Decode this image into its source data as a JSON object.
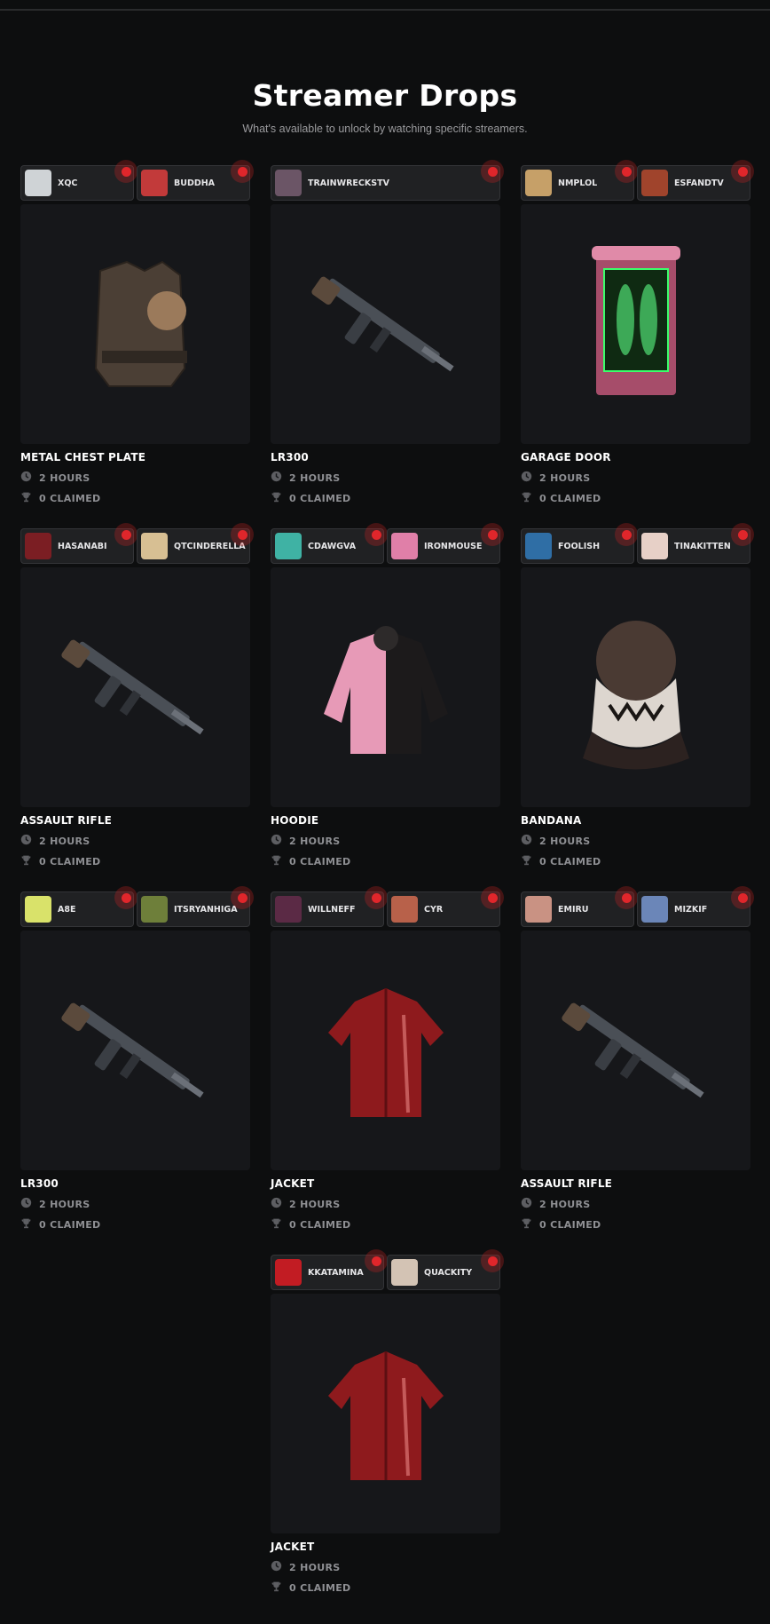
{
  "header": {
    "title": "Streamer Drops",
    "subtitle": "What's available to unlock by watching specific streamers."
  },
  "colors": {
    "background": "#0d0e0f",
    "card": "#16171a",
    "tab": "#202123",
    "live": "#e0262b"
  },
  "drops": [
    {
      "item": "METAL CHEST PLATE",
      "duration": "2 HOURS",
      "claimed": "0 CLAIMED",
      "icon": "chest-plate-icon",
      "streamers": [
        {
          "name": "XQC",
          "color": "#cfd3d6"
        },
        {
          "name": "BUDDHA",
          "color": "#c23a3a"
        }
      ]
    },
    {
      "item": "LR300",
      "duration": "2 HOURS",
      "claimed": "0 CLAIMED",
      "icon": "rifle-icon",
      "streamers": [
        {
          "name": "TRAINWRECKSTV",
          "color": "#6b5566"
        }
      ]
    },
    {
      "item": "GARAGE DOOR",
      "duration": "2 HOURS",
      "claimed": "0 CLAIMED",
      "icon": "garage-door-icon",
      "streamers": [
        {
          "name": "NMPLOL",
          "color": "#c6a068"
        },
        {
          "name": "ESFANDTV",
          "color": "#a0442c"
        }
      ]
    },
    {
      "item": "ASSAULT RIFLE",
      "duration": "2 HOURS",
      "claimed": "0 CLAIMED",
      "icon": "rifle-icon",
      "streamers": [
        {
          "name": "HASANABI",
          "color": "#7b1e23"
        },
        {
          "name": "QTCINDERELLA",
          "color": "#d7bf93"
        }
      ]
    },
    {
      "item": "HOODIE",
      "duration": "2 HOURS",
      "claimed": "0 CLAIMED",
      "icon": "hoodie-icon",
      "streamers": [
        {
          "name": "CDAWGVA",
          "color": "#3fb2a4"
        },
        {
          "name": "IRONMOUSE",
          "color": "#e07fa8"
        }
      ]
    },
    {
      "item": "BANDANA",
      "duration": "2 HOURS",
      "claimed": "0 CLAIMED",
      "icon": "bandana-icon",
      "streamers": [
        {
          "name": "FOOLISH",
          "color": "#2f6ea5"
        },
        {
          "name": "TINAKITTEN",
          "color": "#e7d0c7"
        }
      ]
    },
    {
      "item": "LR300",
      "duration": "2 HOURS",
      "claimed": "0 CLAIMED",
      "icon": "rifle-icon",
      "streamers": [
        {
          "name": "A8E",
          "color": "#d9e26a"
        },
        {
          "name": "ITSRYANHIGA",
          "color": "#6e7f3a"
        }
      ]
    },
    {
      "item": "JACKET",
      "duration": "2 HOURS",
      "claimed": "0 CLAIMED",
      "icon": "jacket-icon",
      "streamers": [
        {
          "name": "WILLNEFF",
          "color": "#5b2a45"
        },
        {
          "name": "CYR",
          "color": "#b8614a"
        }
      ]
    },
    {
      "item": "ASSAULT RIFLE",
      "duration": "2 HOURS",
      "claimed": "0 CLAIMED",
      "icon": "rifle-icon",
      "streamers": [
        {
          "name": "EMIRU",
          "color": "#c99283"
        },
        {
          "name": "MIZKIF",
          "color": "#6b86b8"
        }
      ]
    },
    {
      "item": "JACKET",
      "duration": "2 HOURS",
      "claimed": "0 CLAIMED",
      "icon": "jacket-icon",
      "streamers": [
        {
          "name": "KKATAMINA",
          "color": "#c21c23"
        },
        {
          "name": "QUACKITY",
          "color": "#d3c3b4"
        }
      ]
    }
  ]
}
